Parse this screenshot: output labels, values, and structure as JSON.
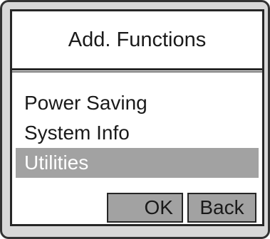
{
  "dialog": {
    "title": "Add. Functions",
    "menu_items": [
      {
        "label": "Power Saving",
        "selected": false
      },
      {
        "label": "System Info",
        "selected": false
      },
      {
        "label": "Utilities",
        "selected": true
      }
    ],
    "ok_label": "OK",
    "back_label": "Back"
  },
  "colors": {
    "frame_background": "#d8d8d8",
    "screen_background": "#ffffff",
    "selection_highlight": "#a2a2a2",
    "button_background": "#a2a2a2",
    "text": "#1a1a1a"
  }
}
